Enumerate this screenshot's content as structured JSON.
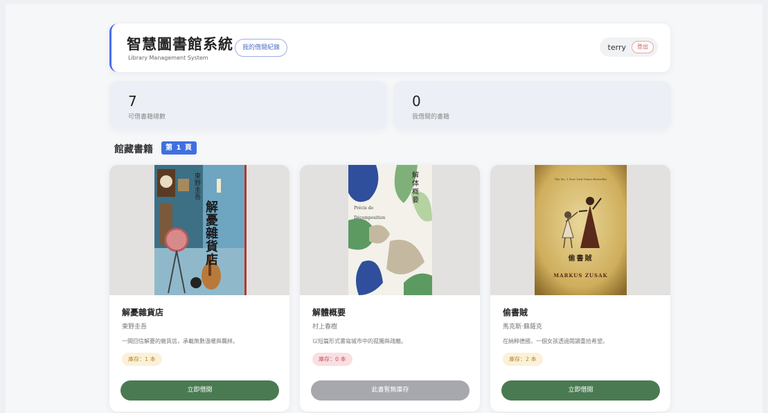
{
  "header": {
    "title": "智慧圖書館系統",
    "subtitle": "Library Management System",
    "history_button": "我的借閱紀錄",
    "username": "terry",
    "logout_button": "登出"
  },
  "stats": [
    {
      "value": "7",
      "label": "可借書籍總數"
    },
    {
      "value": "0",
      "label": "我借閱的書籍"
    }
  ],
  "section": {
    "title": "館藏書籍",
    "page_badge": "第 1 頁"
  },
  "books": [
    {
      "title": "解憂雜貨店",
      "author": "東野圭吾",
      "description": "一間回信解憂的雜貨店，承載無數溫暖與羈絆。",
      "stock": "庫存：1 本",
      "action": "立即借閱",
      "available": true,
      "cover_text": {
        "author": "東野圭吾",
        "title": "解憂雜貨店"
      }
    },
    {
      "title": "解體概要",
      "author": "村上春樹",
      "description": "以短篇形式書寫城市中的孤獨與疏離。",
      "stock": "庫存：0 本",
      "action": "此書暫無庫存",
      "available": false,
      "cover_text": {
        "title": "解体概要",
        "subtitle": "Précis de Décomposition"
      }
    },
    {
      "title": "偷書賊",
      "author": "馬克斯·蘇薩克",
      "description": "在納粹德國，一個女孩透過閱讀重拾希望。",
      "stock": "庫存：2 本",
      "action": "立即借閱",
      "available": true,
      "cover_text": {
        "banner": "The No. 1 New York Times Bestseller",
        "title": "偷書賊",
        "author": "MARKUS ZUSAK"
      }
    }
  ],
  "colors": {
    "accent": "#3f6fe0",
    "borrow_button": "#4a7a52",
    "disabled_button": "#a6a8ad",
    "stock_ok_bg": "#fbf1d9",
    "stock_out_bg": "#f9dfe1"
  }
}
